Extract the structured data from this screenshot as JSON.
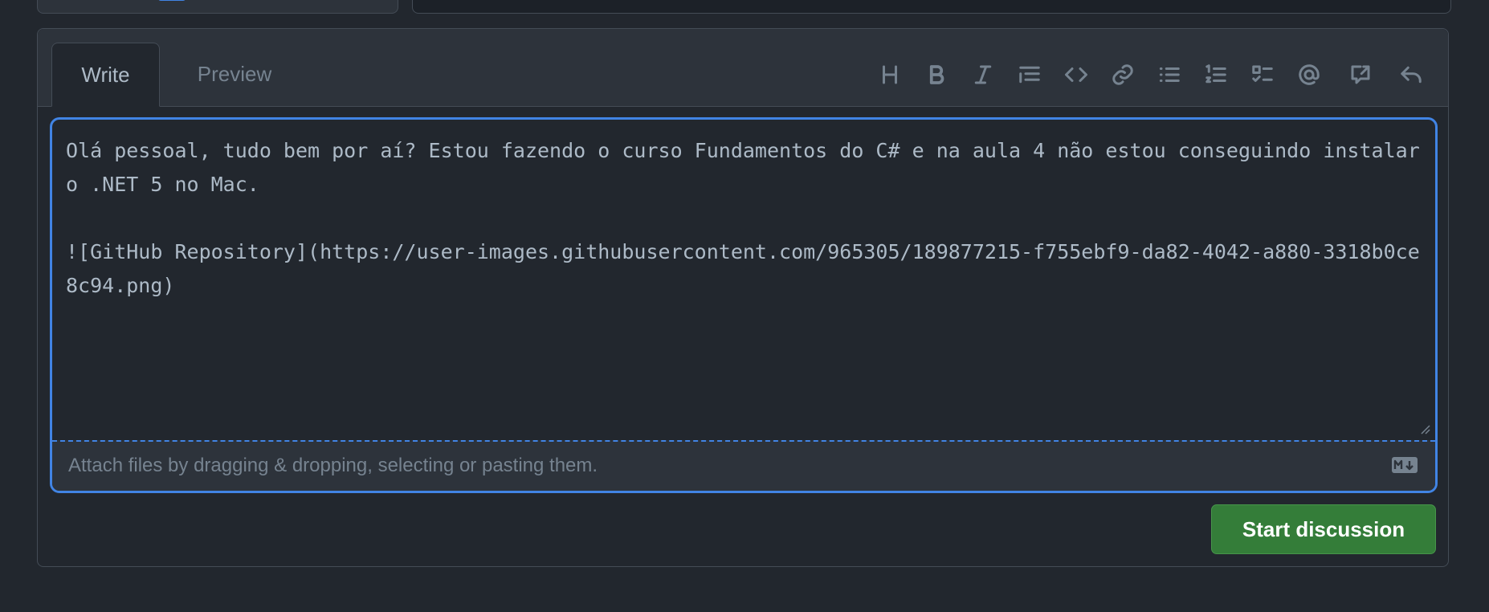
{
  "tabs": {
    "write": "Write",
    "preview": "Preview"
  },
  "toolbar": {
    "icons": [
      "heading-icon",
      "bold-icon",
      "italic-icon",
      "quote-icon",
      "code-icon",
      "link-icon",
      "bulleted-list-icon",
      "numbered-list-icon",
      "task-list-icon",
      "mention-icon",
      "cross-reference-icon",
      "reply-icon"
    ]
  },
  "editor": {
    "value": "Olá pessoal, tudo bem por aí? Estou fazendo o curso Fundamentos do C# e na aula 4 não estou conseguindo instalar o .NET 5 no Mac.\n\n![GitHub Repository](https://user-images.githubusercontent.com/965305/189877215-f755ebf9-da82-4042-a880-3318b0ce8c94.png)"
  },
  "attach": {
    "text": "Attach files by dragging & dropping, selecting or pasting them.",
    "markdown_icon": "markdown-icon"
  },
  "submit": {
    "label": "Start discussion"
  },
  "colors": {
    "background": "#22272e",
    "accent_border": "#4184e4",
    "button_green": "#347d39",
    "muted_text": "#768390"
  }
}
